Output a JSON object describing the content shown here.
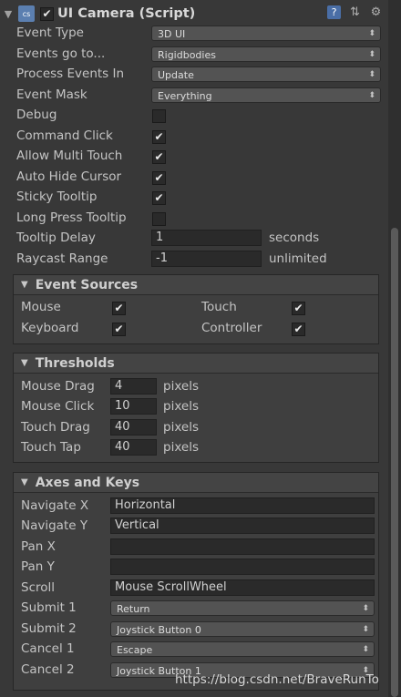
{
  "header": {
    "title": "UI Camera (Script)",
    "enabled": true
  },
  "properties": {
    "event_type": {
      "label": "Event Type",
      "value": "3D UI"
    },
    "events_go_to": {
      "label": "Events go to...",
      "value": "Rigidbodies"
    },
    "process_events_in": {
      "label": "Process Events In",
      "value": "Update"
    },
    "event_mask": {
      "label": "Event Mask",
      "value": "Everything"
    },
    "debug": {
      "label": "Debug",
      "checked": false
    },
    "command_click": {
      "label": "Command Click",
      "checked": true
    },
    "allow_multi_touch": {
      "label": "Allow Multi Touch",
      "checked": true
    },
    "auto_hide_cursor": {
      "label": "Auto Hide Cursor",
      "checked": true
    },
    "sticky_tooltip": {
      "label": "Sticky Tooltip",
      "checked": true
    },
    "long_press_tooltip": {
      "label": "Long Press Tooltip",
      "checked": false
    },
    "tooltip_delay": {
      "label": "Tooltip Delay",
      "value": "1",
      "unit": "seconds"
    },
    "raycast_range": {
      "label": "Raycast Range",
      "value": "-1",
      "unit": "unlimited"
    }
  },
  "event_sources": {
    "title": "Event Sources",
    "mouse": {
      "label": "Mouse",
      "checked": true
    },
    "touch": {
      "label": "Touch",
      "checked": true
    },
    "keyboard": {
      "label": "Keyboard",
      "checked": true
    },
    "controller": {
      "label": "Controller",
      "checked": true
    }
  },
  "thresholds": {
    "title": "Thresholds",
    "rows": [
      {
        "label": "Mouse Drag",
        "value": "4",
        "unit": "pixels"
      },
      {
        "label": "Mouse Click",
        "value": "10",
        "unit": "pixels"
      },
      {
        "label": "Touch Drag",
        "value": "40",
        "unit": "pixels"
      },
      {
        "label": "Touch Tap",
        "value": "40",
        "unit": "pixels"
      }
    ]
  },
  "axes": {
    "title": "Axes and Keys",
    "navigate_x": {
      "label": "Navigate X",
      "value": "Horizontal"
    },
    "navigate_y": {
      "label": "Navigate Y",
      "value": "Vertical"
    },
    "pan_x": {
      "label": "Pan X",
      "value": ""
    },
    "pan_y": {
      "label": "Pan Y",
      "value": ""
    },
    "scroll": {
      "label": "Scroll",
      "value": "Mouse ScrollWheel"
    },
    "submit_1": {
      "label": "Submit 1",
      "value": "Return"
    },
    "submit_2": {
      "label": "Submit 2",
      "value": "Joystick Button 0"
    },
    "cancel_1": {
      "label": "Cancel 1",
      "value": "Escape"
    },
    "cancel_2": {
      "label": "Cancel 2",
      "value": "Joystick Button 1"
    }
  },
  "glyphs": {
    "check": "✔",
    "dropdown_arrow": "⬍",
    "fold_open": "▼",
    "help": "?",
    "gear": "⚙",
    "preset": "⇅"
  },
  "watermark": "https://blog.csdn.net/BraveRunTo",
  "colors": {
    "background": "#383838",
    "section_bg": "#3f3f3f",
    "field_bg": "#2a2a2a",
    "dropdown_bg": "#535353",
    "text": "#c4c4c4"
  }
}
